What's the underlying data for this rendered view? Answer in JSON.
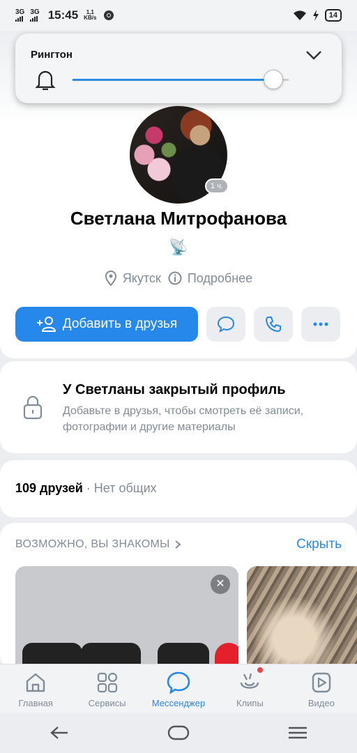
{
  "status_bar": {
    "sim1": "3G",
    "sim2": "3G",
    "time": "15:45",
    "speed_value": "1,1",
    "speed_unit": "KB/s",
    "battery": "14"
  },
  "volume_popup": {
    "title": "Рингтон",
    "level": 0.93
  },
  "profile": {
    "online_badge": "1 ч.",
    "name": "Светлана Митрофанова",
    "status_emoji": "📡",
    "city": "Якутск",
    "more_label": "Подробнее",
    "add_friend_label": "Добавить в друзья"
  },
  "closed_profile": {
    "title": "У Светланы закрытый профиль",
    "description": "Добавьте в друзья, чтобы смотреть её записи, фотографии и другие материалы"
  },
  "friends": {
    "count_label": "109 друзей",
    "separator": " · ",
    "common_label": "Нет общих"
  },
  "suggestions": {
    "title": "ВОЗМОЖНО, ВЫ ЗНАКОМЫ",
    "hide_label": "Скрыть"
  },
  "tabbar": {
    "items": [
      {
        "label": "Главная",
        "icon": "home-icon"
      },
      {
        "label": "Сервисы",
        "icon": "services-icon"
      },
      {
        "label": "Мессенджер",
        "icon": "messenger-icon",
        "active": true
      },
      {
        "label": "Клипы",
        "icon": "clips-icon"
      },
      {
        "label": "Видео",
        "icon": "video-icon"
      }
    ]
  },
  "colors": {
    "accent": "#2688eb",
    "secondary_text": "#818c99",
    "background": "#ebedf0"
  }
}
